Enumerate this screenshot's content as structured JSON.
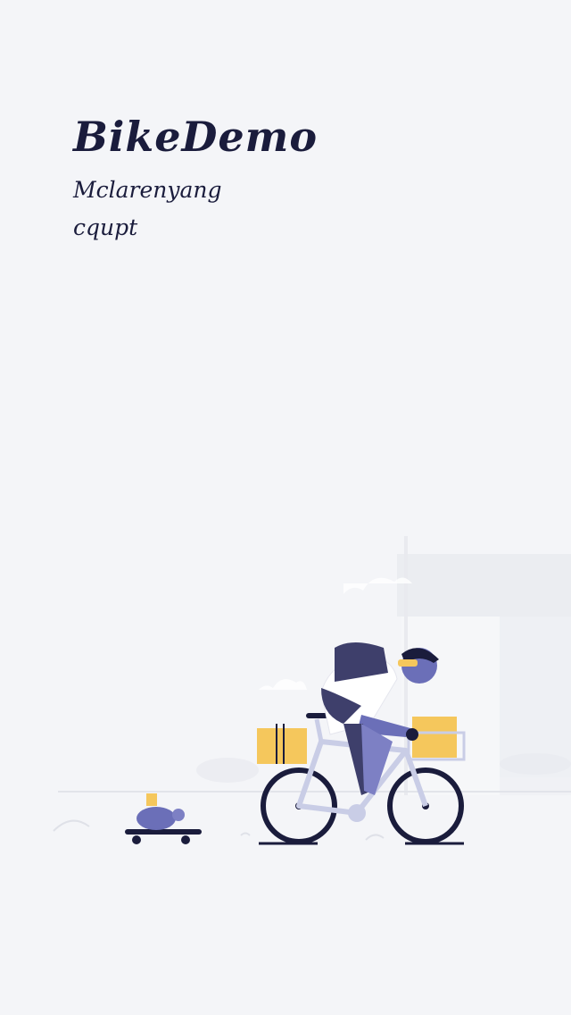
{
  "splash": {
    "app_title": "BikeDemo",
    "author": "Mclarenyang",
    "school": "cqupt"
  },
  "illustration": {
    "subject": "delivery cyclist with packages, turtle on skateboard",
    "colors": {
      "background": "#f4f5f8",
      "ink": "#1a1c3c",
      "accent_purple": "#6b6fb8",
      "accent_yellow": "#f5c75c",
      "house": "#eceef3"
    }
  }
}
